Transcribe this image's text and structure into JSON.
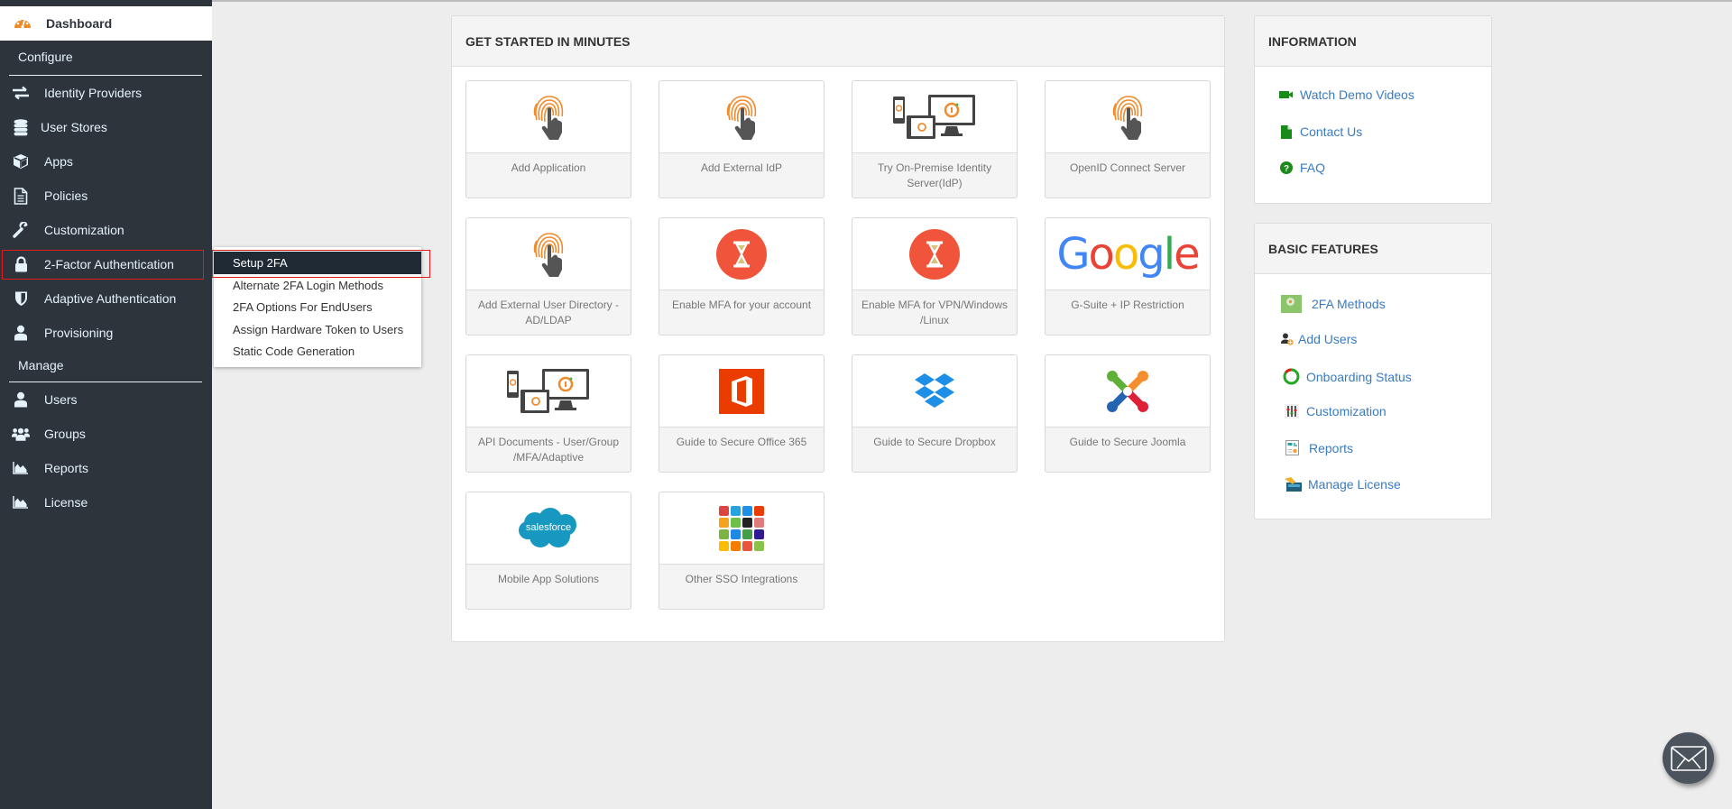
{
  "sidebar": {
    "dashboard_label": "Dashboard",
    "section_configure": "Configure",
    "section_manage": "Manage",
    "configure_items": [
      {
        "label": "Identity Providers",
        "icon": "arrows-exchange-icon"
      },
      {
        "label": "User Stores",
        "icon": "database-icon"
      },
      {
        "label": "Apps",
        "icon": "cube-icon"
      },
      {
        "label": "Policies",
        "icon": "document-icon"
      },
      {
        "label": "Customization",
        "icon": "wrench-icon"
      },
      {
        "label": "2-Factor Authentication",
        "icon": "lock-icon",
        "highlighted": true
      },
      {
        "label": "Adaptive Authentication",
        "icon": "shield-icon"
      },
      {
        "label": "Provisioning",
        "icon": "user-icon"
      }
    ],
    "manage_items": [
      {
        "label": "Users",
        "icon": "user-icon"
      },
      {
        "label": "Groups",
        "icon": "users-icon"
      },
      {
        "label": "Reports",
        "icon": "area-chart-icon"
      },
      {
        "label": "License",
        "icon": "area-chart-icon"
      }
    ]
  },
  "popup_menu": {
    "items": [
      {
        "label": "Setup 2FA",
        "active": true
      },
      {
        "label": "Alternate 2FA Login Methods"
      },
      {
        "label": "2FA Options For EndUsers"
      },
      {
        "label": "Assign Hardware Token to Users"
      },
      {
        "label": "Static Code Generation"
      }
    ]
  },
  "get_started": {
    "title": "GET STARTED IN MINUTES",
    "cards": [
      {
        "label": "Add Application",
        "icon": "fingerprint-icon"
      },
      {
        "label": "Add External IdP",
        "icon": "fingerprint-icon"
      },
      {
        "label": "Try On-Premise Identity Server(IdP)",
        "icon": "devices-icon"
      },
      {
        "label": "OpenID Connect Server",
        "icon": "fingerprint-icon"
      },
      {
        "label": "Add External User Directory - AD/LDAP",
        "icon": "fingerprint-icon"
      },
      {
        "label": "Enable MFA for your account",
        "icon": "hourglass-icon"
      },
      {
        "label": "Enable MFA for VPN/Windows /Linux",
        "icon": "hourglass-icon"
      },
      {
        "label": "G-Suite + IP Restriction",
        "icon": "google-logo"
      },
      {
        "label": "API Documents - User/Group /MFA/Adaptive",
        "icon": "devices-icon"
      },
      {
        "label": "Guide to Secure Office 365",
        "icon": "office365-logo"
      },
      {
        "label": "Guide to Secure Dropbox",
        "icon": "dropbox-logo"
      },
      {
        "label": "Guide to Secure Joomla",
        "icon": "joomla-logo"
      },
      {
        "label": "Mobile App Solutions",
        "icon": "salesforce-logo"
      },
      {
        "label": "Other SSO Integrations",
        "icon": "app-grid-icon"
      }
    ],
    "google_text": "Google",
    "salesforce_text": "salesforce"
  },
  "information": {
    "title": "INFORMATION",
    "links": [
      {
        "label": "Watch Demo Videos",
        "icon": "video-camera-icon"
      },
      {
        "label": "Contact Us",
        "icon": "file-icon"
      },
      {
        "label": "FAQ",
        "icon": "question-circle-icon"
      }
    ]
  },
  "basic_features": {
    "title": "BASIC FEATURES",
    "links": [
      {
        "label": "2FA Methods",
        "icon": "2fa-methods-icon"
      },
      {
        "label": "Add Users",
        "icon": "add-user-icon"
      },
      {
        "label": "Onboarding Status",
        "icon": "onboarding-ring-icon"
      },
      {
        "label": "Customization",
        "icon": "sliders-icon"
      },
      {
        "label": "Reports",
        "icon": "report-icon"
      },
      {
        "label": "Manage License",
        "icon": "license-card-icon"
      }
    ]
  },
  "colors": {
    "sidebar_bg": "#2e343c",
    "accent_orange": "#f08a24",
    "link_blue": "#3a7bbf",
    "highlight_red": "#e01b1b",
    "popup_active_bg": "#1f2a35"
  },
  "chat_button": {
    "icon": "envelope-icon"
  }
}
